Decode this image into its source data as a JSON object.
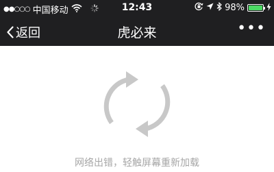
{
  "status_bar": {
    "signal_dots": "●●○○○",
    "carrier": "中国移动",
    "time": "12:43",
    "battery_percent": "98%",
    "battery_level": 0.98,
    "icons": [
      "wifi-icon",
      "loading-spinner-icon",
      "orientation-lock-icon",
      "location-arrow-icon",
      "bluetooth-icon",
      "charging-bolt-icon"
    ]
  },
  "nav": {
    "back_label": "返回",
    "title": "虎必来",
    "more_label": "•••"
  },
  "content": {
    "message": "网络出错，轻触屏幕重新加载"
  },
  "colors": {
    "nav_background": "#1f1f21",
    "battery_fill": "#4cd964",
    "icon_gray": "#c8c8c8",
    "message_gray": "#a6a6a6"
  }
}
